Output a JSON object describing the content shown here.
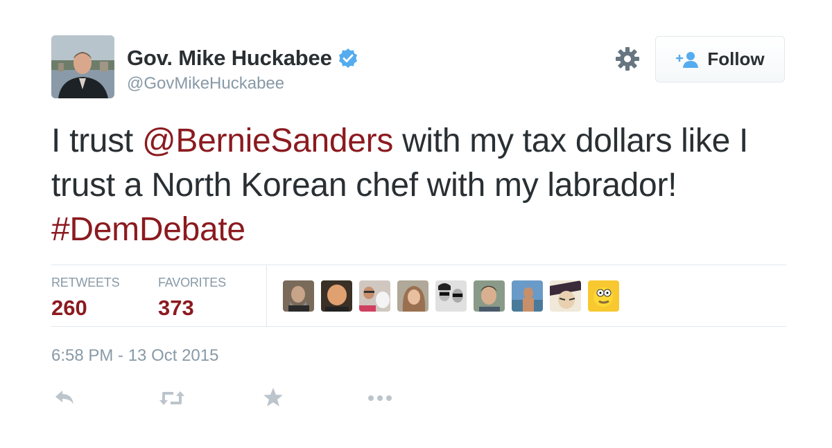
{
  "user": {
    "display_name": "Gov. Mike Huckabee",
    "handle": "@GovMikeHuckabee",
    "verified": true
  },
  "actions_header": {
    "settings_icon": "gear-icon",
    "follow_label": "Follow"
  },
  "tweet": {
    "text_parts": [
      {
        "text": "I trust ",
        "type": "plain"
      },
      {
        "text": "@BernieSanders",
        "type": "mention"
      },
      {
        "text": " with my tax dollars like I trust a North Korean chef with my labrador! ",
        "type": "plain"
      },
      {
        "text": "#DemDebate",
        "type": "hashtag"
      }
    ]
  },
  "stats": {
    "retweets_label": "RETWEETS",
    "retweets_count": "260",
    "favorites_label": "FAVORITES",
    "favorites_count": "373"
  },
  "timestamp": "6:58 PM - 13 Oct 2015",
  "footer_actions": [
    "reply-icon",
    "retweet-icon",
    "favorite-icon",
    "more-icon"
  ],
  "colors": {
    "link": "#8b1a1f",
    "muted": "#8899a6",
    "verified": "#55acee"
  }
}
